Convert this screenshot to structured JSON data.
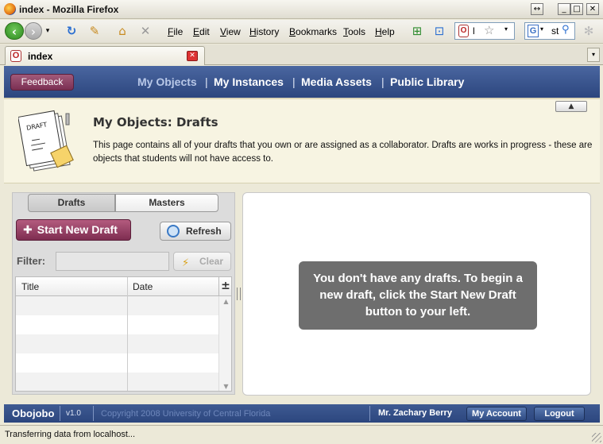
{
  "window": {
    "title": "index - Mozilla Firefox",
    "controls": [
      "↔",
      "_",
      "□",
      "✕"
    ]
  },
  "browser": {
    "menus": [
      "File",
      "Edit",
      "View",
      "History",
      "Bookmarks",
      "Tools",
      "Help"
    ],
    "url_fragment": "l",
    "search_text": "st",
    "search_engine_label": "G"
  },
  "tab": {
    "label": "index",
    "favicon_letter": "O"
  },
  "app": {
    "feedback_label": "Feedback",
    "nav": [
      {
        "label": "My Objects",
        "active": true
      },
      {
        "label": "My Instances",
        "active": false
      },
      {
        "label": "Media Assets",
        "active": false
      },
      {
        "label": "Public Library",
        "active": false
      }
    ],
    "nav_separator": "|",
    "collapse_glyph": "▲"
  },
  "banner": {
    "title": "My Objects: Drafts",
    "description": "This page contains all of your drafts that you own or are assigned as a collaborator.  Drafts are works in progress - these are objects that students will not have access to.",
    "illustration_label": "DRAFT"
  },
  "left_panel": {
    "tabs": {
      "drafts": "Drafts",
      "masters": "Masters"
    },
    "start_new_draft": "Start New Draft",
    "refresh": "Refresh",
    "filter_label": "Filter:",
    "filter_value": "",
    "clear": "Clear",
    "table": {
      "columns": [
        "Title",
        "Date"
      ],
      "rows": []
    }
  },
  "right_panel": {
    "empty_message": "You don't have any drafts.  To begin a new draft, click the Start New Draft button to your left."
  },
  "footer": {
    "brand": "Obojobo",
    "version": "v1.0",
    "copyright": "Copyright 2008 University of Central Florida",
    "user": "Mr. Zachary Berry",
    "my_account": "My Account",
    "logout": "Logout"
  },
  "status": {
    "text": "Transferring data from localhost..."
  },
  "colors": {
    "header_blue": "#2c467e",
    "accent_plum": "#7e2d51",
    "banner_bg": "#f7f4e2"
  }
}
